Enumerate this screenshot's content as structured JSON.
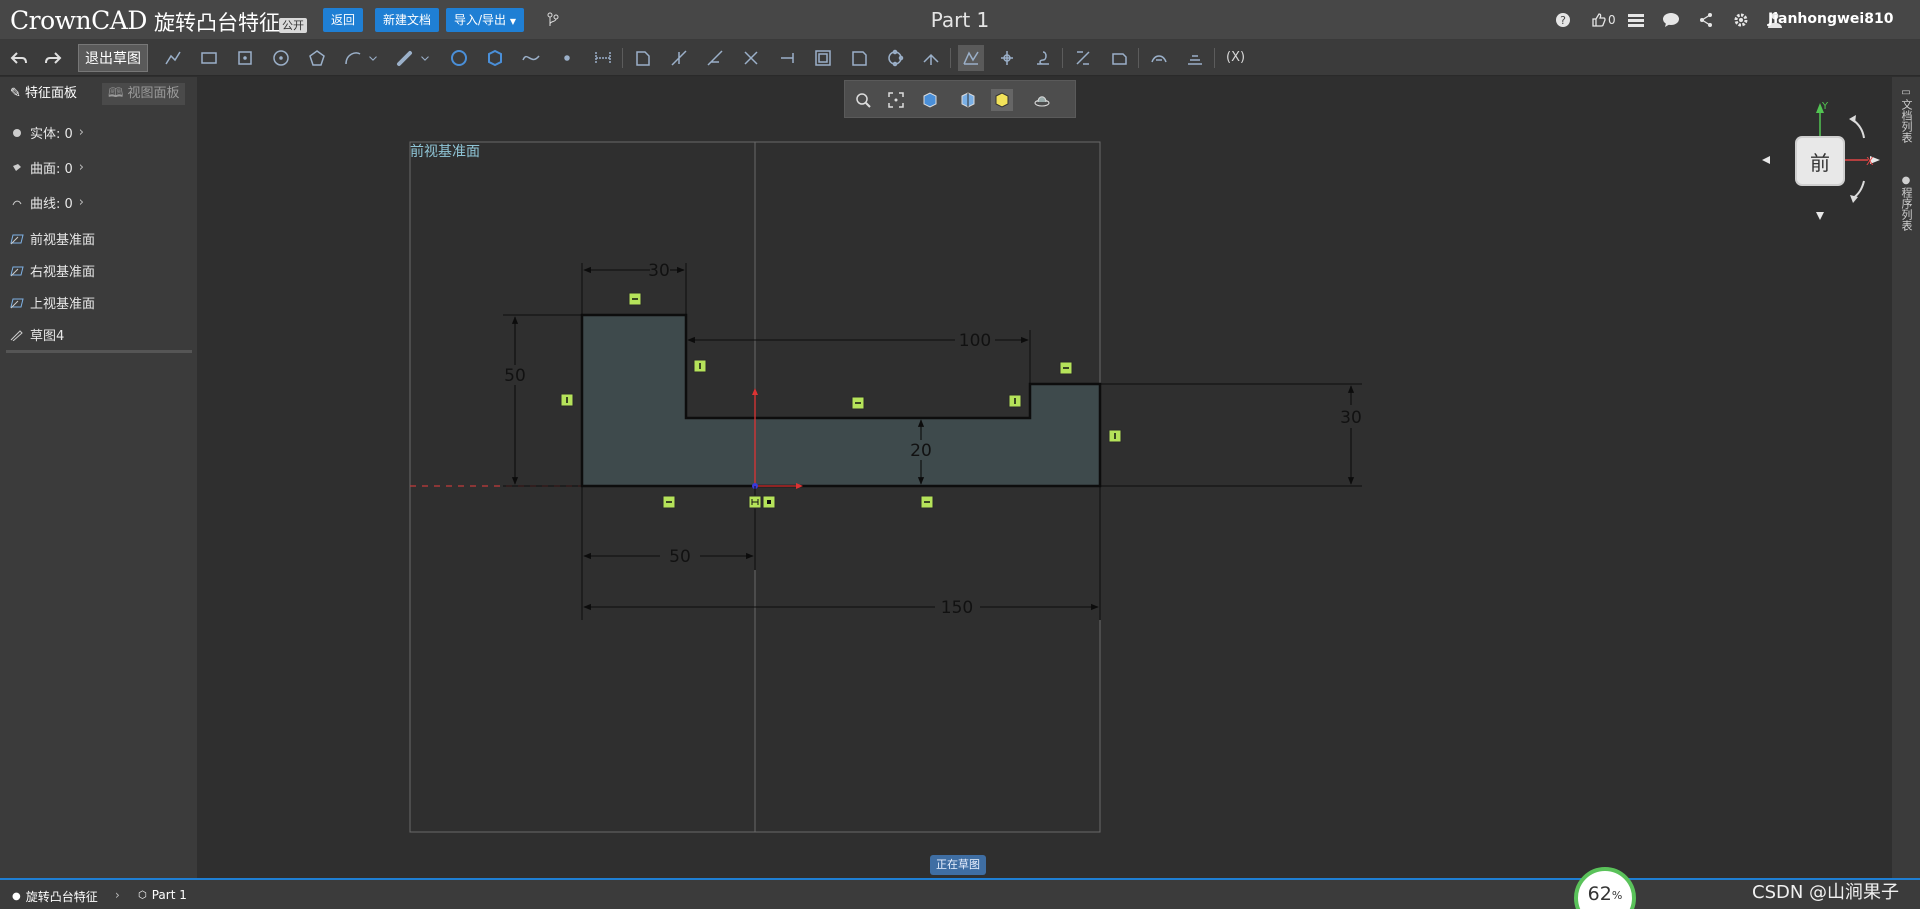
{
  "header": {
    "logo": "CrownCAD",
    "doc_title": "旋转凸台特征",
    "visibility": "公开",
    "btn_back": "返回",
    "btn_new_doc": "新建文档",
    "btn_import_export": "导入/导出",
    "part_title": "Part 1",
    "likes": "0",
    "username": "Jianhongwei810"
  },
  "toolbar": {
    "exit_sketch": "退出草图",
    "param_label": "(X)"
  },
  "left_panel": {
    "tab_feature": "特征面板",
    "tab_view": "视图面板",
    "solids": "实体: 0",
    "surfaces": "曲面: 0",
    "curves": "曲线: 0",
    "tree": [
      "前视基准面",
      "右视基准面",
      "上视基准面",
      "草图4"
    ]
  },
  "canvas": {
    "plane_label": "前视基准面",
    "dimensions": {
      "top_width": "30",
      "left_height": "50",
      "slot_width": "100",
      "bottom_thickness": "20",
      "right_height": "30",
      "origin_offset": "50",
      "total_width": "150"
    }
  },
  "right_bar": {
    "doc_list": "文档列表",
    "program_list": "程序列表"
  },
  "view_cube": {
    "face": "前",
    "axis_x": "X",
    "axis_y": "Y"
  },
  "status": {
    "sketching": "正在草图",
    "breadcrumb_doc": "旋转凸台特征",
    "breadcrumb_part": "Part 1",
    "progress": "62",
    "progress_unit": "%",
    "watermark": "CSDN @山涧果子"
  },
  "colors": {
    "accent": "#1f7fd4",
    "profile_fill": "#3e4a4c",
    "constraint": "#b5e35a"
  }
}
